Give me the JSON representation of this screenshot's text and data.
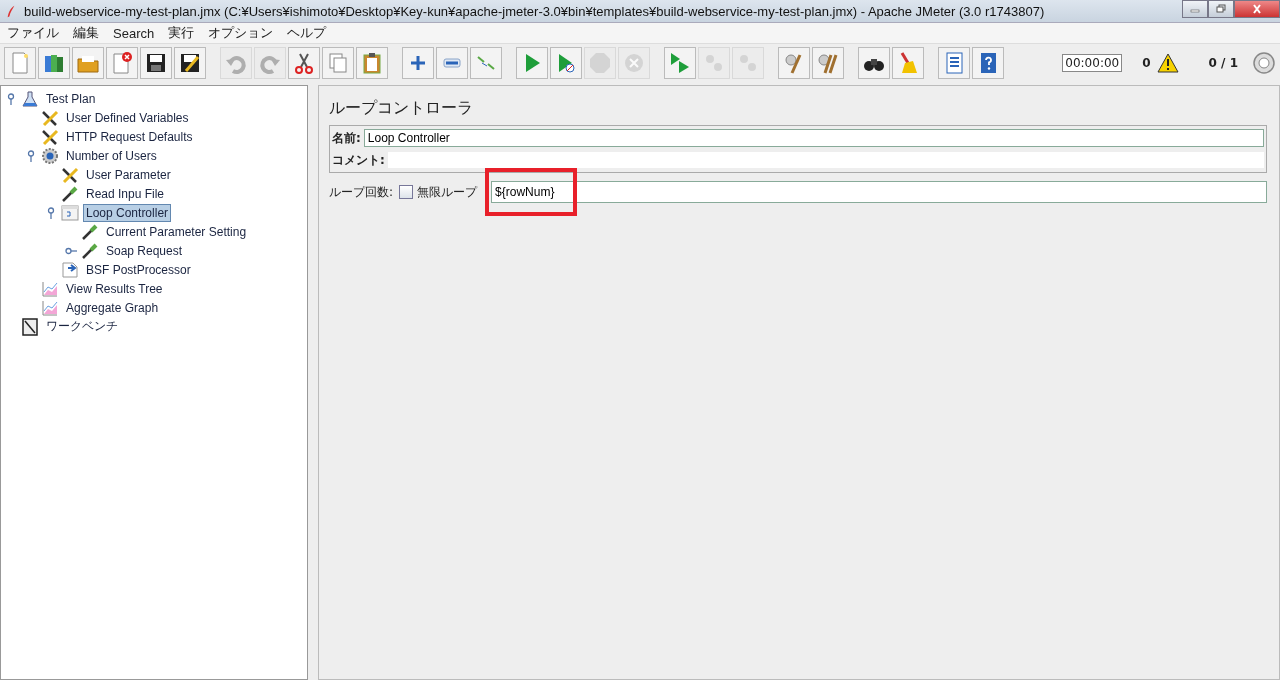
{
  "window": {
    "title": "build-webservice-my-test-plan.jmx (C:¥Users¥ishimoto¥Desktop¥Key-kun¥apache-jmeter-3.0¥bin¥templates¥build-webservice-my-test-plan.jmx) - Apache JMeter (3.0 r1743807)"
  },
  "menu": [
    "ファイル",
    "編集",
    "Search",
    "実行",
    "オプション",
    "ヘルプ"
  ],
  "toolbar": [
    {
      "kind": "new",
      "disabled": false
    },
    {
      "kind": "templates",
      "disabled": false
    },
    {
      "kind": "open",
      "disabled": false
    },
    {
      "kind": "close",
      "disabled": false
    },
    {
      "kind": "save",
      "disabled": false
    },
    {
      "kind": "saveas",
      "disabled": false
    },
    {
      "kind": "sep"
    },
    {
      "kind": "undo",
      "disabled": true
    },
    {
      "kind": "redo",
      "disabled": true
    },
    {
      "kind": "cut",
      "disabled": false
    },
    {
      "kind": "copy",
      "disabled": false
    },
    {
      "kind": "paste",
      "disabled": false
    },
    {
      "kind": "sep"
    },
    {
      "kind": "expand",
      "disabled": false
    },
    {
      "kind": "collapse",
      "disabled": false
    },
    {
      "kind": "toggle",
      "disabled": false
    },
    {
      "kind": "sep"
    },
    {
      "kind": "start",
      "disabled": false
    },
    {
      "kind": "startnopause",
      "disabled": false
    },
    {
      "kind": "stop",
      "disabled": true
    },
    {
      "kind": "shutdown",
      "disabled": true
    },
    {
      "kind": "sep"
    },
    {
      "kind": "remotestart",
      "disabled": false
    },
    {
      "kind": "remotestop",
      "disabled": true
    },
    {
      "kind": "remoteexit",
      "disabled": true
    },
    {
      "kind": "sep"
    },
    {
      "kind": "clear",
      "disabled": false
    },
    {
      "kind": "clearall",
      "disabled": false
    },
    {
      "kind": "sep"
    },
    {
      "kind": "search",
      "disabled": false
    },
    {
      "kind": "resetsearch",
      "disabled": false
    },
    {
      "kind": "sep"
    },
    {
      "kind": "functions",
      "disabled": false
    },
    {
      "kind": "help",
      "disabled": false
    }
  ],
  "status": {
    "timer": "00:00:00",
    "errors": "0",
    "threads": "0 / 1"
  },
  "tree": [
    {
      "label": "Test Plan",
      "kind": "plan",
      "selected": false,
      "expanded": true,
      "children": [
        {
          "label": "User Defined Variables",
          "kind": "tools",
          "selected": false
        },
        {
          "label": "HTTP Request Defaults",
          "kind": "tools",
          "selected": false
        },
        {
          "label": "Number of Users",
          "kind": "gear",
          "selected": false,
          "expanded": true,
          "children": [
            {
              "label": "User Parameter",
              "kind": "tools",
              "selected": false
            },
            {
              "label": "Read Inpu File",
              "kind": "dropper",
              "selected": false
            },
            {
              "label": "Loop Controller",
              "kind": "loop",
              "selected": true,
              "expanded": true,
              "children": [
                {
                  "label": "Current Parameter Setting",
                  "kind": "dropper",
                  "selected": false
                },
                {
                  "label": "Soap Request",
                  "kind": "dropper",
                  "selected": false,
                  "expanded": false
                }
              ]
            },
            {
              "label": "BSF PostProcessor",
              "kind": "post",
              "selected": false
            }
          ]
        },
        {
          "label": "View Results Tree",
          "kind": "graph",
          "selected": false
        },
        {
          "label": "Aggregate Graph",
          "kind": "graph",
          "selected": false
        }
      ]
    },
    {
      "label": "ワークベンチ",
      "kind": "bench",
      "selected": false
    }
  ],
  "panel": {
    "title": "ループコントローラ",
    "name_label": "名前:",
    "name_value": "Loop Controller",
    "comment_label": "コメント:",
    "loops_label": "ループ回数:",
    "infinite": {
      "label": "無限ループ",
      "checked": false
    },
    "loops_value": "${rowNum}",
    "highlighted": true
  }
}
